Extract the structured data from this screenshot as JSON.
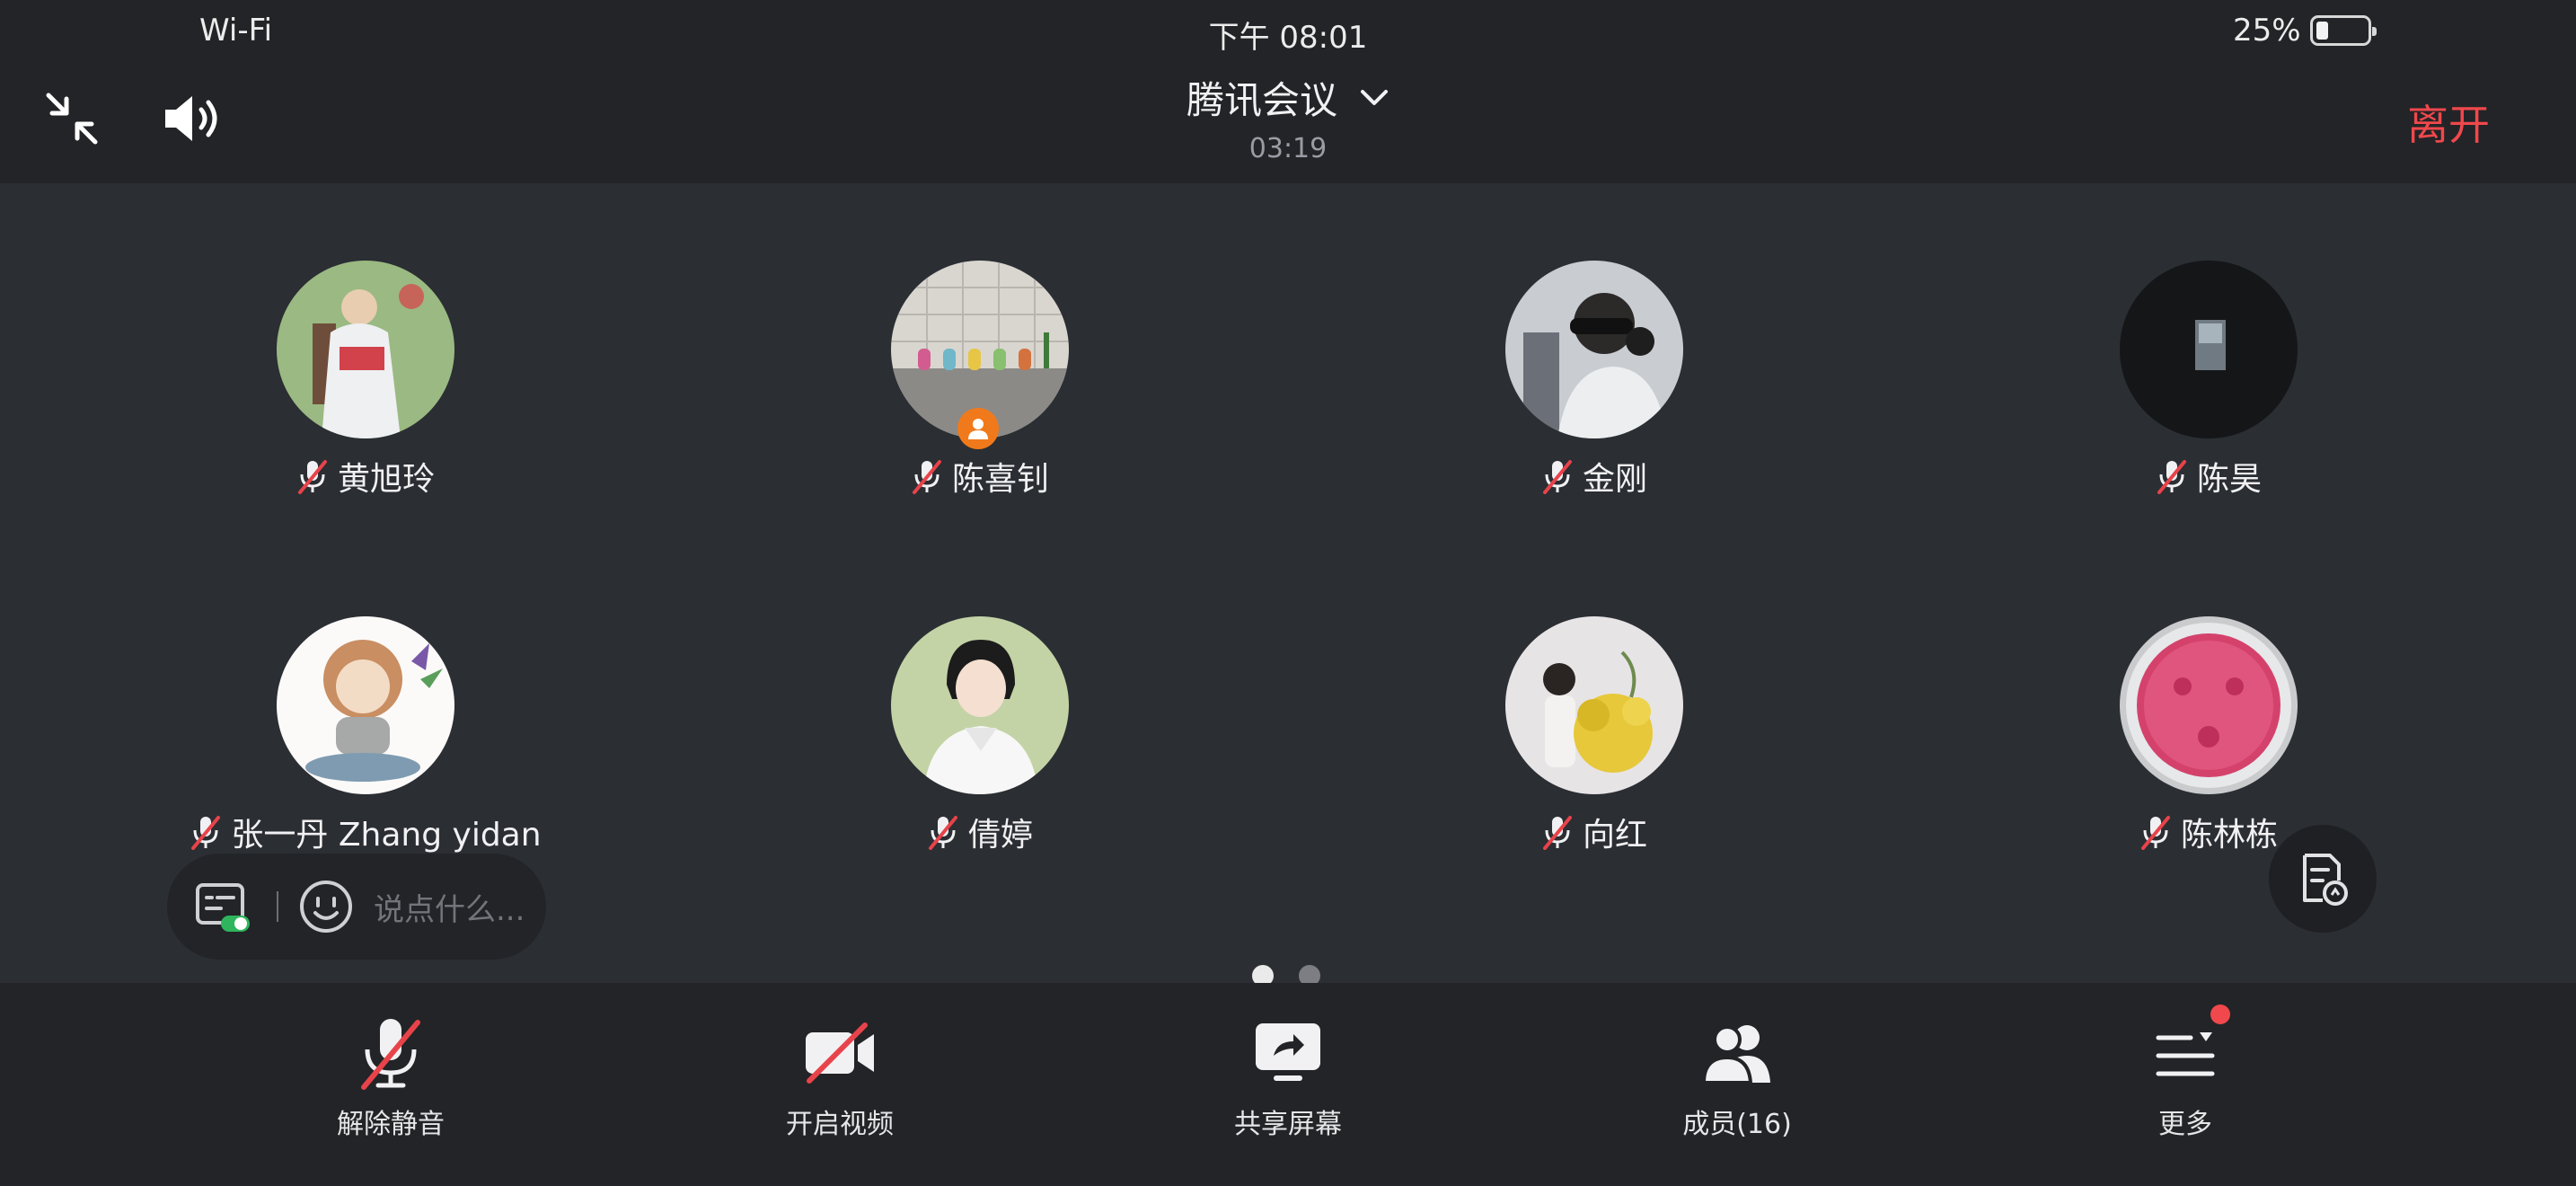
{
  "status_bar": {
    "network": "Wi-Fi",
    "time": "下午 08:01",
    "battery_percent": "25%",
    "battery_level": 0.25
  },
  "header": {
    "meeting_title": "腾讯会议",
    "duration": "03:19",
    "leave_label": "离开",
    "icons": [
      "minimize-icon",
      "speaker-icon",
      "chevron-down-icon"
    ]
  },
  "participants": [
    {
      "name": "黄旭玲",
      "muted": true,
      "avatar": "illustration-woman-chair"
    },
    {
      "name": "陈喜钊",
      "muted": true,
      "avatar": "shelf-figurines",
      "host": true
    },
    {
      "name": "金刚",
      "muted": true,
      "avatar": "man-headphones"
    },
    {
      "name": "陈昊",
      "muted": true,
      "avatar": "dark-room"
    },
    {
      "name": "张一丹 Zhang yidan",
      "muted": true,
      "avatar": "cartoon-girl-meditating"
    },
    {
      "name": "倩婷",
      "muted": true,
      "avatar": "woman-white-blouse"
    },
    {
      "name": "向红",
      "muted": true,
      "avatar": "woman-yellow-flowers"
    },
    {
      "name": "陈林栋",
      "muted": true,
      "avatar": "pink-dish"
    }
  ],
  "chat": {
    "placeholder": "说点什么..."
  },
  "pagination": {
    "pages": 2,
    "current": 1
  },
  "toolbar": {
    "unmute_label": "解除静音",
    "video_label": "开启视频",
    "share_label": "共享屏幕",
    "members_label": "成员(16)",
    "more_label": "更多"
  },
  "colors": {
    "background": "#2b2e33",
    "bar": "#232427",
    "leave": "#f0484c",
    "host_badge": "#f07a1b",
    "mute_slash": "#e8434a",
    "notification_dot": "#f0484c"
  }
}
